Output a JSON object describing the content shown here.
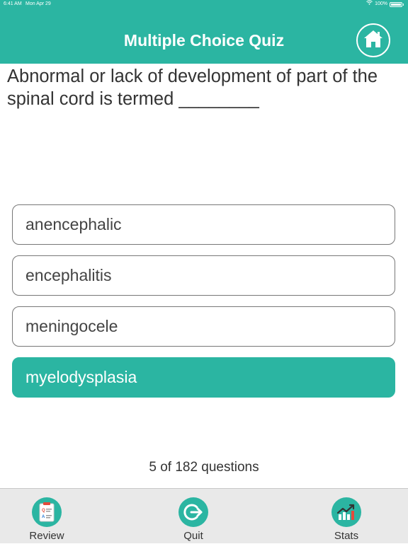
{
  "status_bar": {
    "time": "6:41 AM",
    "date": "Mon Apr 29",
    "battery": "100%"
  },
  "header": {
    "title": "Multiple Choice Quiz",
    "home_icon": "home-icon"
  },
  "question": {
    "text": "Abnormal or lack of development of part of the spinal cord is termed ________"
  },
  "options": [
    {
      "label": "anencephalic",
      "selected": false
    },
    {
      "label": "encephalitis",
      "selected": false
    },
    {
      "label": "meningocele",
      "selected": false
    },
    {
      "label": "myelodysplasia",
      "selected": true
    }
  ],
  "progress": {
    "text": "5 of 182 questions"
  },
  "tabbar": {
    "items": [
      {
        "label": "Review",
        "icon": "review-clipboard-icon"
      },
      {
        "label": "Quit",
        "icon": "quit-exit-icon"
      },
      {
        "label": "Stats",
        "icon": "stats-chart-icon"
      }
    ]
  },
  "colors": {
    "accent": "#2bb5a2",
    "tabbar_bg": "#e9e9e9",
    "text": "#333333"
  }
}
